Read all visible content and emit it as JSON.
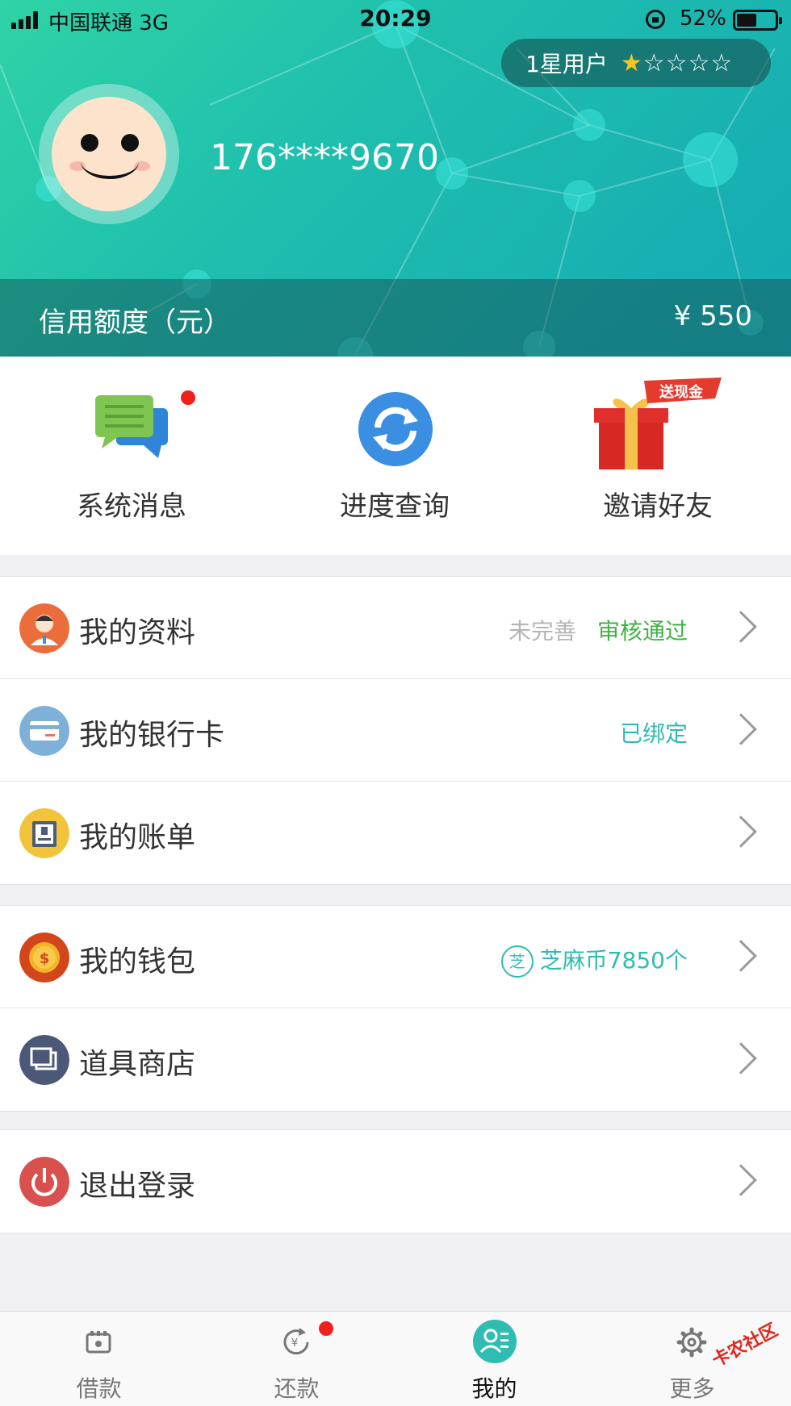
{
  "status_bar": {
    "carrier": "中国联通   3G",
    "time": "20:29",
    "battery": "52%"
  },
  "profile": {
    "level_label": "1星用户",
    "stars": {
      "filled": 1,
      "total": 5
    },
    "phone": "176****9670",
    "credit_label": "信用额度（元）",
    "credit_value": "¥ 550"
  },
  "quick_actions": [
    {
      "label": "系统消息",
      "icon": "chat-bubbles-icon",
      "badge": true
    },
    {
      "label": "进度查询",
      "icon": "refresh-icon",
      "badge": false
    },
    {
      "label": "邀请好友",
      "icon": "gift-icon",
      "ribbon": "送现金"
    }
  ],
  "menu": {
    "profile": {
      "title": "我的资料",
      "status_muted": "未完善",
      "status": "审核通过"
    },
    "bank_card": {
      "title": "我的银行卡",
      "status": "已绑定"
    },
    "bill": {
      "title": "我的账单"
    },
    "wallet": {
      "title": "我的钱包",
      "coin_icon_char": "芝",
      "status": "芝麻币7850个"
    },
    "shop": {
      "title": "道具商店"
    },
    "logout": {
      "title": "退出登录"
    }
  },
  "tabs": [
    {
      "label": "借款",
      "icon": "wallet-icon"
    },
    {
      "label": "还款",
      "icon": "repay-icon",
      "badge": true
    },
    {
      "label": "我的",
      "icon": "user-icon",
      "active": true
    },
    {
      "label": "更多",
      "icon": "gear-icon"
    }
  ],
  "watermark": "卡农社区",
  "colors": {
    "accent": "#2fbcb1",
    "approved": "#42b244",
    "badge": "#f0201c",
    "star": "#f7c520"
  }
}
